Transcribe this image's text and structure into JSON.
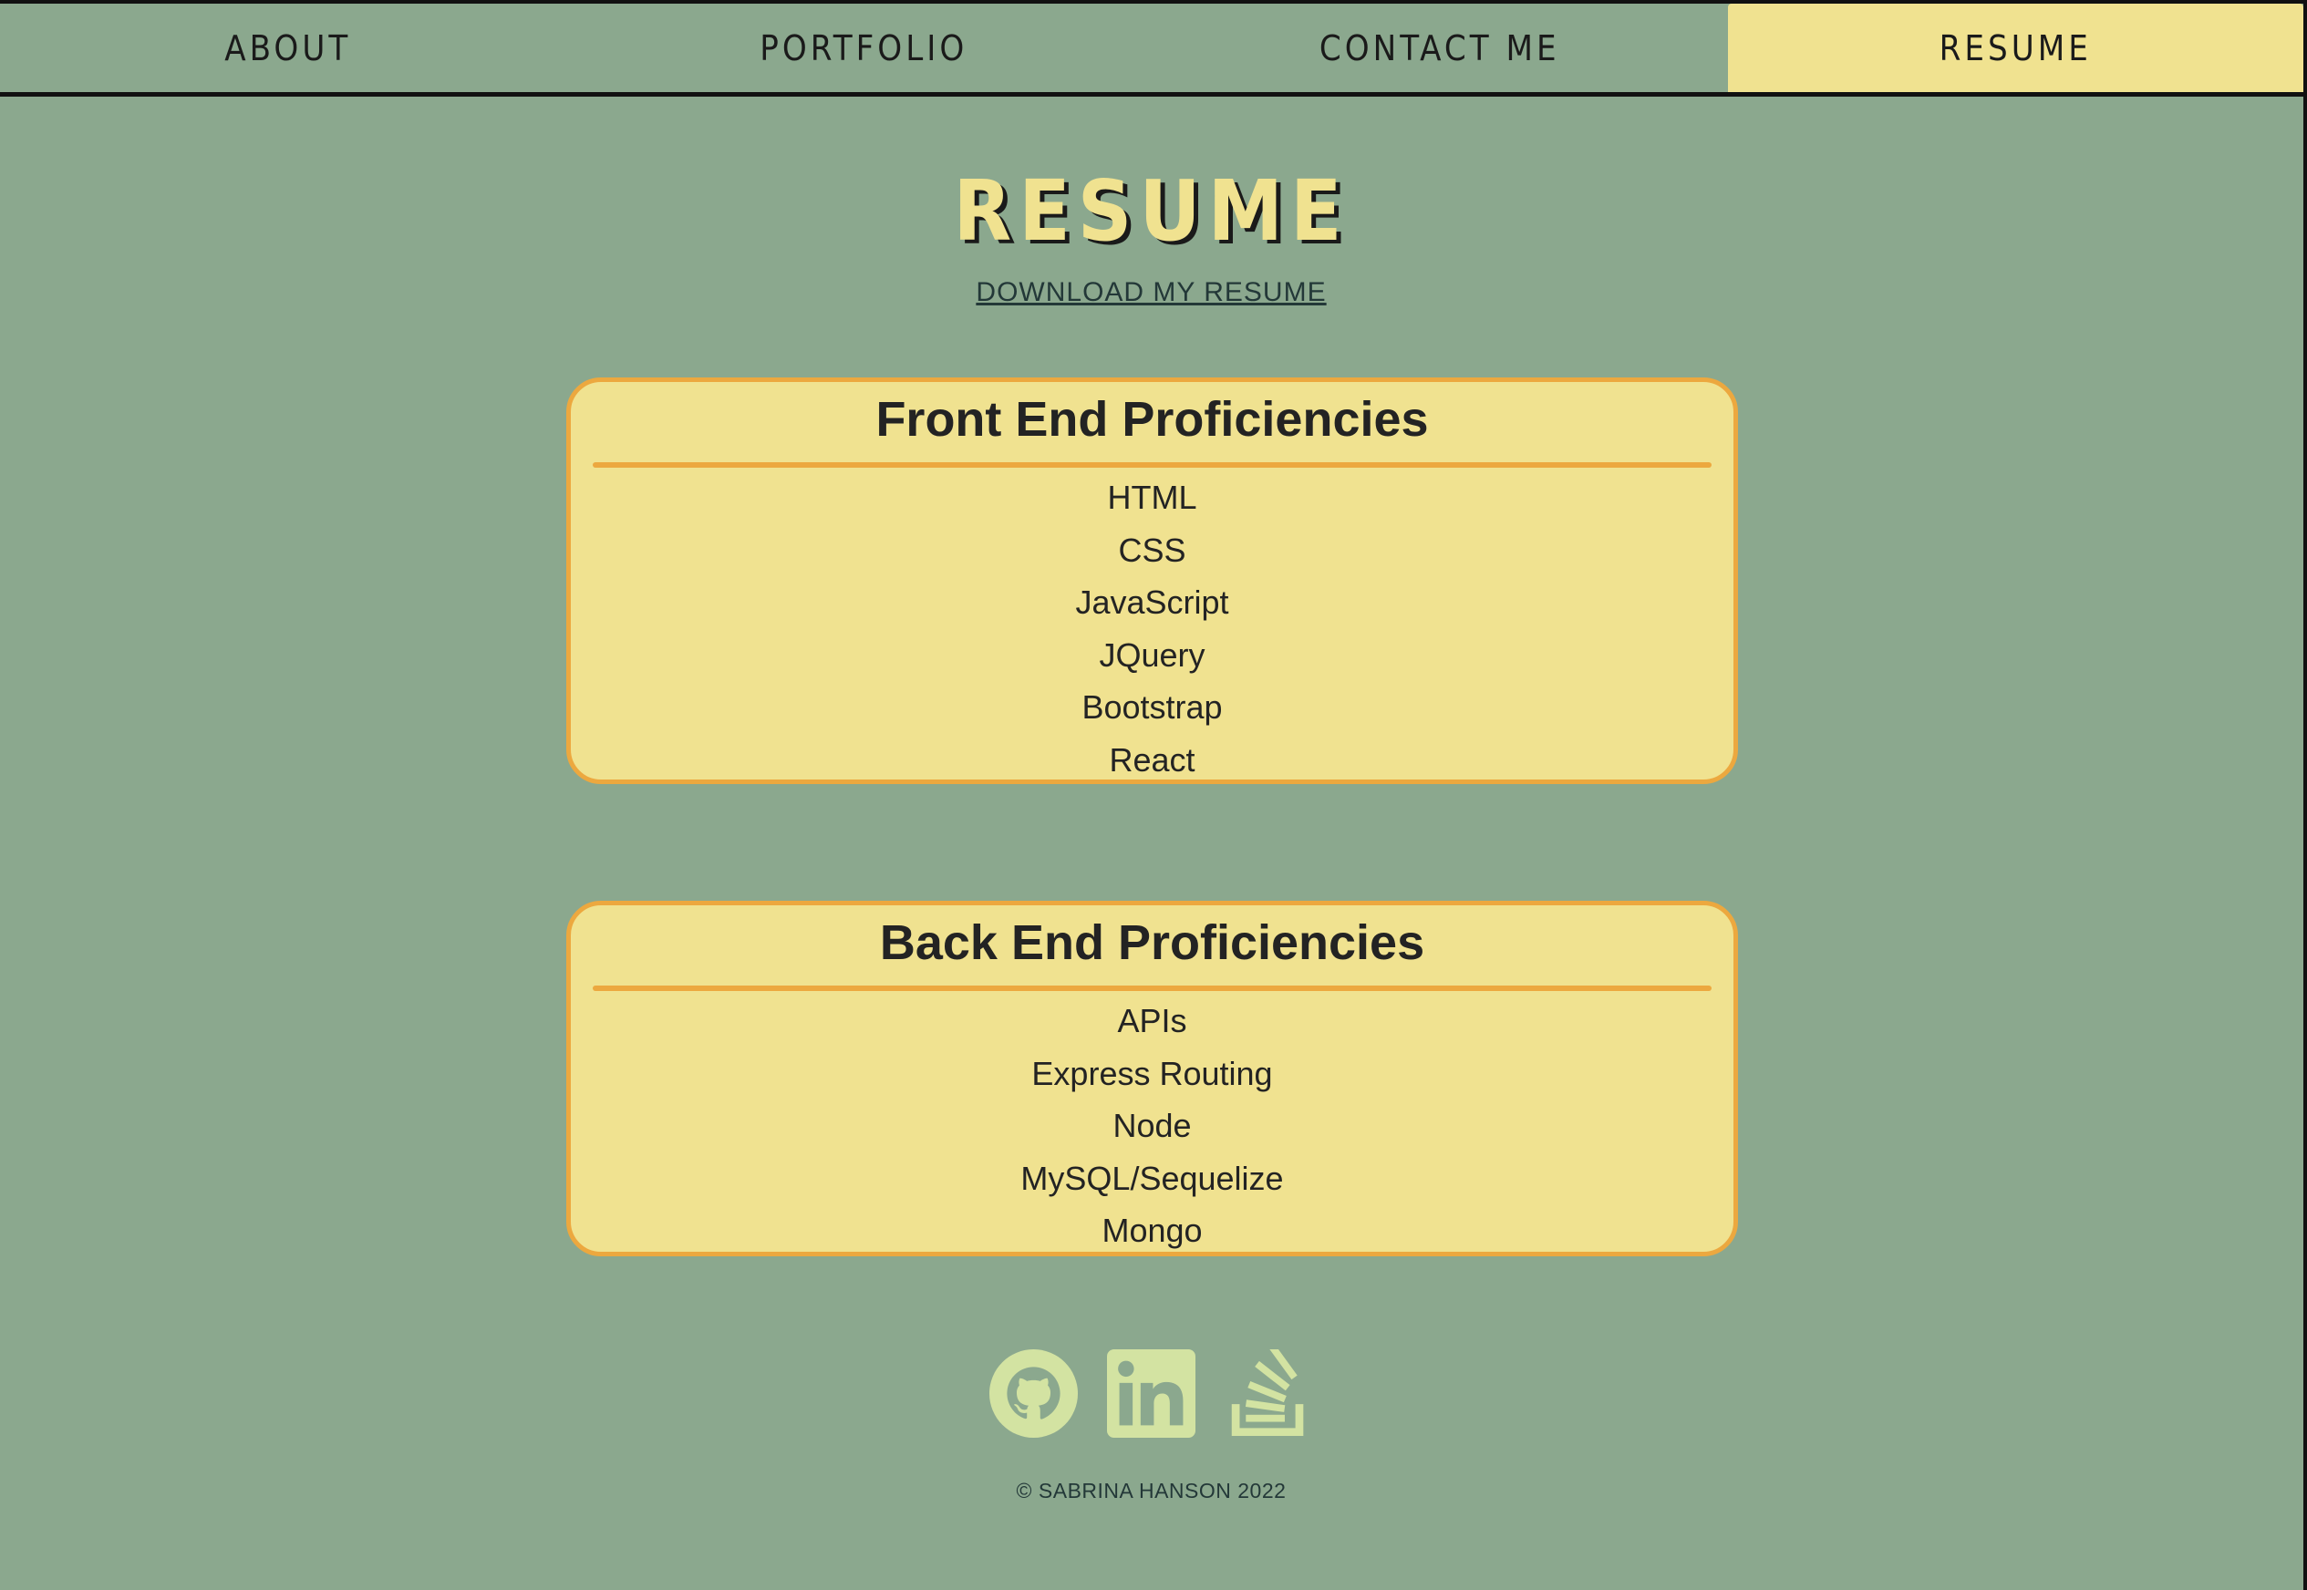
{
  "nav": {
    "items": [
      {
        "label": "ABOUT"
      },
      {
        "label": "PORTFOLIO"
      },
      {
        "label": "CONTACT ME"
      },
      {
        "label": "RESUME",
        "active": true
      }
    ]
  },
  "header": {
    "title": "RESUME",
    "download_link": "DOWNLOAD MY RESUME"
  },
  "front_end": {
    "title": "Front End Proficiencies",
    "items": [
      "HTML",
      "CSS",
      "JavaScript",
      "JQuery",
      "Bootstrap",
      "React"
    ]
  },
  "back_end": {
    "title": "Back End Proficiencies",
    "items": [
      "APIs",
      "Express Routing",
      "Node",
      "MySQL/Sequelize",
      "Mongo"
    ]
  },
  "footer": {
    "social_icons": [
      "github-icon",
      "linkedin-icon",
      "stackoverflow-icon"
    ],
    "copyright": "© SABRINA HANSON 2022"
  },
  "colors": {
    "background": "#8ba88e",
    "accent_yellow": "#f0e290",
    "card_border": "#eca83f",
    "icon": "#d3e3a2"
  }
}
